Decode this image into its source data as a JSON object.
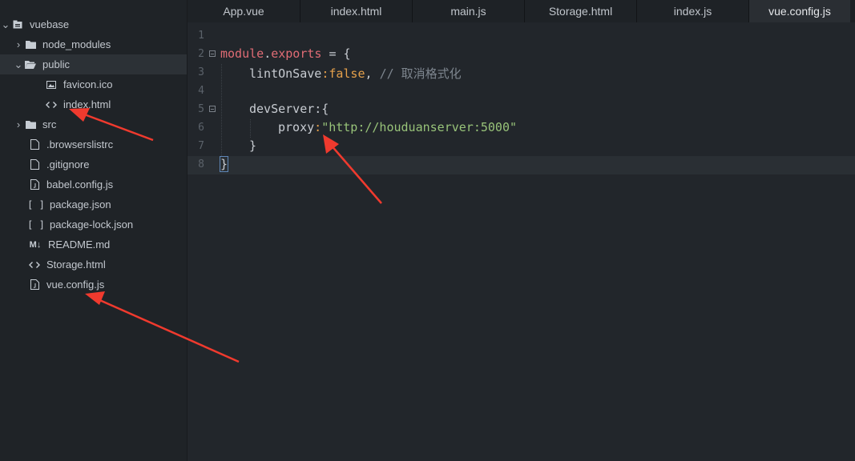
{
  "sidebar": {
    "root": "vuebase",
    "items": [
      {
        "label": "node_modules",
        "type": "folder"
      },
      {
        "label": "public",
        "type": "folder-open"
      },
      {
        "label": "favicon.ico",
        "type": "image"
      },
      {
        "label": "index.html",
        "type": "html"
      },
      {
        "label": "src",
        "type": "folder"
      },
      {
        "label": ".browserslistrc",
        "type": "file"
      },
      {
        "label": ".gitignore",
        "type": "file"
      },
      {
        "label": "babel.config.js",
        "type": "js"
      },
      {
        "label": "package.json",
        "type": "json"
      },
      {
        "label": "package-lock.json",
        "type": "json"
      },
      {
        "label": "README.md",
        "type": "markdown"
      },
      {
        "label": "Storage.html",
        "type": "html"
      },
      {
        "label": "vue.config.js",
        "type": "js"
      }
    ]
  },
  "tabs": [
    {
      "label": "App.vue"
    },
    {
      "label": "index.html"
    },
    {
      "label": "main.js"
    },
    {
      "label": "Storage.html"
    },
    {
      "label": "index.js"
    },
    {
      "label": "vue.config.js",
      "active": true
    }
  ],
  "editor": {
    "line_numbers": [
      "1",
      "2",
      "3",
      "4",
      "5",
      "6",
      "7",
      "8"
    ],
    "tokens": {
      "l2_module": "module",
      "l2_dot": ".",
      "l2_exports": "exports",
      "l2_eq": " = {",
      "l3_key": "lintOnSave",
      "l3_colon": ":",
      "l3_val": "false",
      "l3_comma": ", ",
      "l3_comment": "// 取消格式化",
      "l5_key": "devServer",
      "l5_brace": ":{",
      "l6_key": "proxy",
      "l6_colon": ":",
      "l6_str": "\"http://houduanserver:5000\"",
      "l7_brace": "}",
      "l8_brace": "}"
    }
  },
  "colors": {
    "arrow": "#f03a2e",
    "keyword": "#e06c75",
    "value": "#e5a04b",
    "string": "#98c379"
  }
}
